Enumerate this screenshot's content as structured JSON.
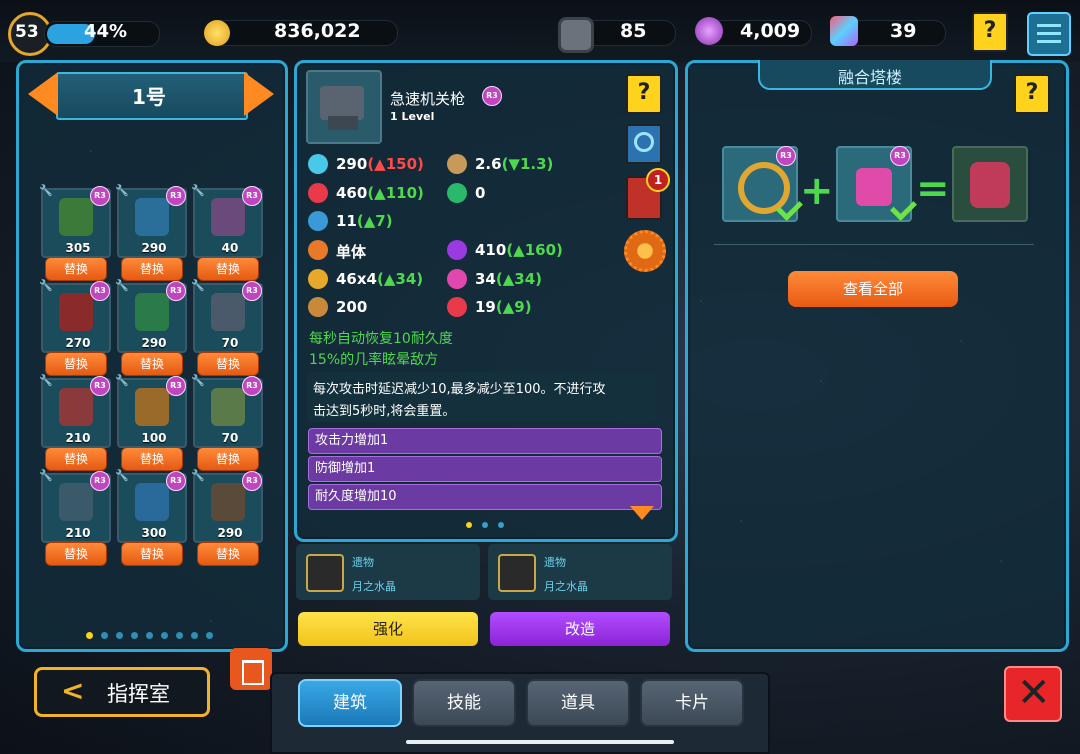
{
  "topbar": {
    "level": "53",
    "xp_percent_text": "44%",
    "xp_fraction": 0.44,
    "coins": "836,022",
    "bolts": "85",
    "crystals": "4,009",
    "gems": "39",
    "help_label": "?"
  },
  "left_panel": {
    "title": "1号",
    "swap_label": "替换",
    "towers": [
      {
        "value": "305",
        "icon": "missile-launcher-icon"
      },
      {
        "value": "290",
        "icon": "radar-dish-icon"
      },
      {
        "value": "40",
        "icon": "spike-box-icon"
      },
      {
        "value": "270",
        "icon": "telescope-cannon-icon"
      },
      {
        "value": "290",
        "icon": "crystal-tower-icon"
      },
      {
        "value": "70",
        "icon": "shield-robot-icon"
      },
      {
        "value": "210",
        "icon": "red-reactor-icon"
      },
      {
        "value": "100",
        "icon": "ring-cannon-icon"
      },
      {
        "value": "70",
        "icon": "green-turret-icon"
      },
      {
        "value": "210",
        "icon": "hex-wall-icon"
      },
      {
        "value": "300",
        "icon": "plasma-dish-icon"
      },
      {
        "value": "290",
        "icon": "gatling-gun-icon"
      }
    ],
    "page_count": 9,
    "page_active": 0
  },
  "detail": {
    "name": "急速机关枪",
    "level": "1 Level",
    "badge": "R3",
    "stats": [
      {
        "icon": "attack-diamond-icon",
        "base": "290",
        "delta": "(▲150)",
        "color": "red"
      },
      {
        "icon": "clock-icon",
        "base": "2.6",
        "delta": "(▼1.3)",
        "color": "green"
      },
      {
        "icon": "heart-icon",
        "base": "460",
        "delta": "(▲110)",
        "color": "green"
      },
      {
        "icon": "shield-lock-icon",
        "base": "0",
        "delta": "",
        "color": "green"
      },
      {
        "icon": "defense-shield-icon",
        "base": "11",
        "delta": "(▲7)",
        "color": "green"
      },
      {
        "icon": "target-icon",
        "base": "单体",
        "delta": "",
        "color": "green"
      },
      {
        "icon": "purple-flame-icon",
        "base": "410",
        "delta": "(▲160)",
        "color": "green"
      },
      {
        "icon": "burst-icon",
        "base": "46x4",
        "delta": "(▲34)",
        "color": "green"
      },
      {
        "icon": "pink-arrow-icon",
        "base": "34",
        "delta": "(▲34)",
        "color": "green"
      },
      {
        "icon": "gear-range-icon",
        "base": "200",
        "delta": "",
        "color": "green"
      },
      {
        "icon": "pacman-icon",
        "base": "19",
        "delta": "(▲9)",
        "color": "green"
      }
    ],
    "passive_1": "每秒自动恢复10耐久度",
    "passive_2": "15%的几率眩晕敌方",
    "desc_line_1": "每次攻击时延迟减少10,最多减少至100。不进行攻",
    "desc_line_2": "击达到5秒时,将会重置。",
    "buffs": [
      "攻击力增加1",
      "防御增加1",
      "耐久度增加10"
    ],
    "notify_count": "1"
  },
  "relics": [
    {
      "label": "遗物",
      "name": "月之水晶"
    },
    {
      "label": "遗物",
      "name": "月之水晶"
    }
  ],
  "actions": {
    "enhance": "强化",
    "modify": "改造"
  },
  "fusion": {
    "title": "融合塔楼",
    "view_all": "查看全部"
  },
  "nav": {
    "back_label": "指挥室",
    "tabs": [
      "建筑",
      "技能",
      "道具",
      "卡片"
    ]
  },
  "colors": {
    "accent": "#2ba9d4",
    "orange": "#ff7a2a",
    "yellow": "#ffd21e",
    "purple": "#9b3ae0",
    "close_red": "#e8262a"
  }
}
